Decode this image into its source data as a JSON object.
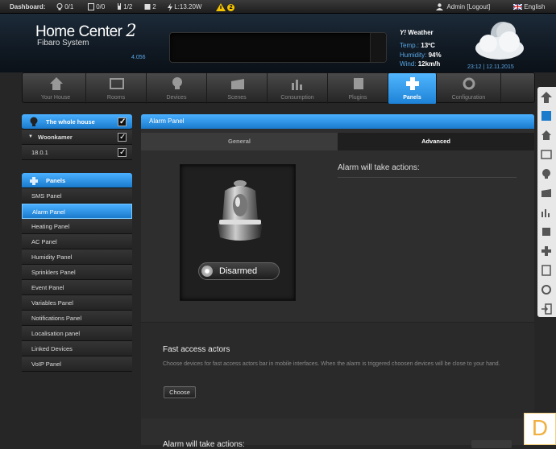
{
  "topbar": {
    "dashboard_label": "Dashboard:",
    "lights": "0/1",
    "blinds": "0/0",
    "gates": "1/2",
    "doors": "2",
    "power": "L:13.20W",
    "alerts": "2",
    "user": "Admin [Logout]",
    "language": "English"
  },
  "header": {
    "brand": "Home Center",
    "brand_num": "2",
    "subtitle": "Fibaro System",
    "version": "4.056"
  },
  "weather": {
    "title": "Weather",
    "temp_label": "Temp.:",
    "temp": "13ºC",
    "hum_label": "Humidity:",
    "hum": "94%",
    "wind_label": "Wind:",
    "wind": "12km/h",
    "datetime": "23:12 | 12.11.2015"
  },
  "nav": [
    "Your House",
    "Rooms",
    "Devices",
    "Scenes",
    "Consumption",
    "Plugins",
    "Panels",
    "Configuration"
  ],
  "sidebar": {
    "house": "The whole house",
    "room": "Woonkamer",
    "device": "18.0.1",
    "panels_title": "Panels",
    "panels": [
      "SMS Panel",
      "Alarm Panel",
      "Heating Panel",
      "AC Panel",
      "Humidity Panel",
      "Sprinklers Panel",
      "Event Panel",
      "Variables Panel",
      "Notifications Panel",
      "Localisation panel",
      "Linked Devices",
      "VoIP Panel"
    ]
  },
  "main": {
    "title": "Alarm Panel",
    "tab_general": "General",
    "tab_advanced": "Advanced",
    "disarmed": "Disarmed",
    "actions_title": "Alarm will take actions:",
    "fa_title": "Fast access actors",
    "fa_desc": "Choose devices for fast access actors bar in mobile interfaces. When the alarm is triggered choosen devices will be close to your hand.",
    "choose": "Choose",
    "actions_title2": "Alarm will take actions:"
  },
  "colors": {
    "accent": "#2a90e6",
    "bg": "#262626"
  }
}
